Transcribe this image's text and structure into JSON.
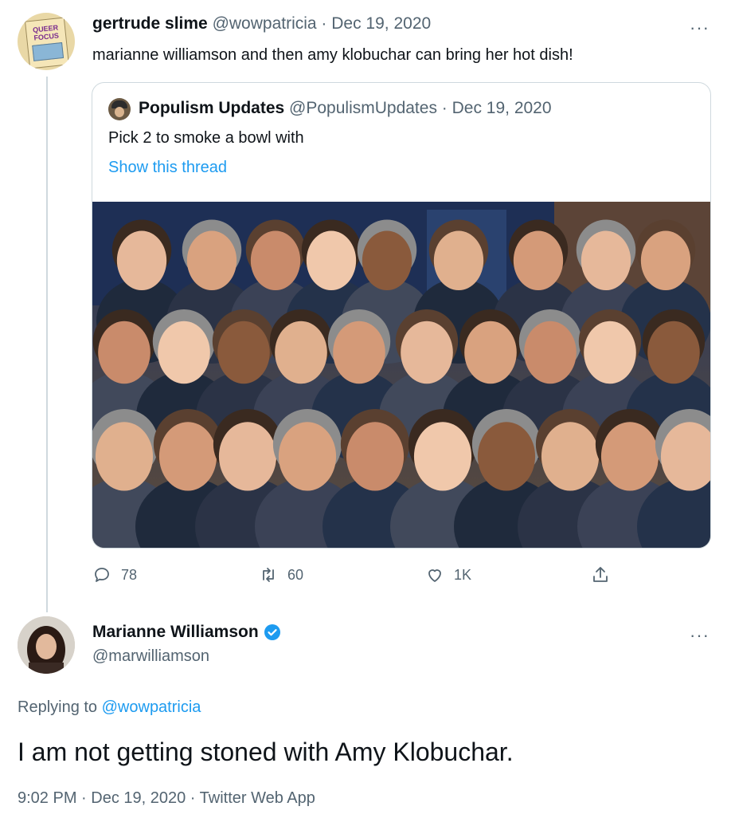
{
  "tweet": {
    "display_name": "gertrude slime",
    "handle_date": "@wowpatricia · Dec 19, 2020",
    "text": "marianne williamson and then amy klobuchar can bring her hot dish!",
    "avatar_text_1": "QUEER",
    "avatar_text_2": "FOCUS",
    "more_label": "···"
  },
  "quote": {
    "display_name": "Populism Updates",
    "handle_date": "@PopulismUpdates · Dec 19, 2020",
    "text": "Pick 2 to smoke a bowl with",
    "thread_link": "Show this thread"
  },
  "actions": {
    "replies": "78",
    "retweets": "60",
    "likes": "1K"
  },
  "reply": {
    "display_name": "Marianne Williamson",
    "handle": "@marwilliamson",
    "replying_prefix": "Replying to",
    "replying_to": "@wowpatricia",
    "text": "I am not getting stoned with Amy Klobuchar.",
    "meta": "9:02 PM · Dec 19, 2020 · Twitter Web App",
    "more_label": "···",
    "verified_icon": "verified-badge-icon",
    "accent": "#1d9bf0"
  }
}
